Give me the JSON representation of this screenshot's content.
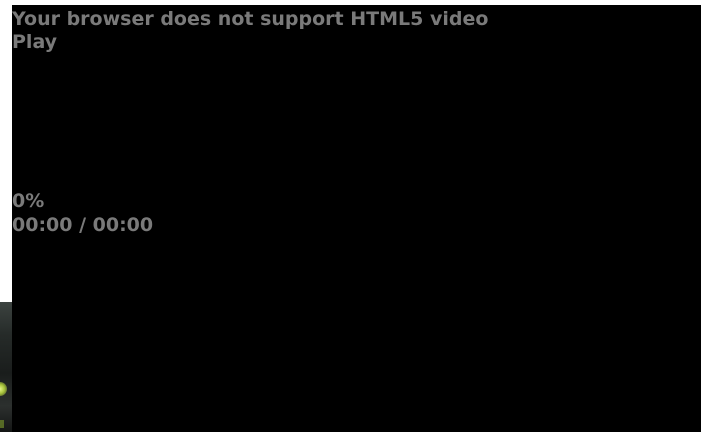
{
  "player": {
    "fallback_message": "Your browser does not support HTML5 video",
    "play_label": "Play",
    "progress_label": "0%",
    "progress_value": 0,
    "time_display": "00:00 / 00:00"
  },
  "colors": {
    "background": "#000000",
    "text": "#7a7a7a"
  }
}
